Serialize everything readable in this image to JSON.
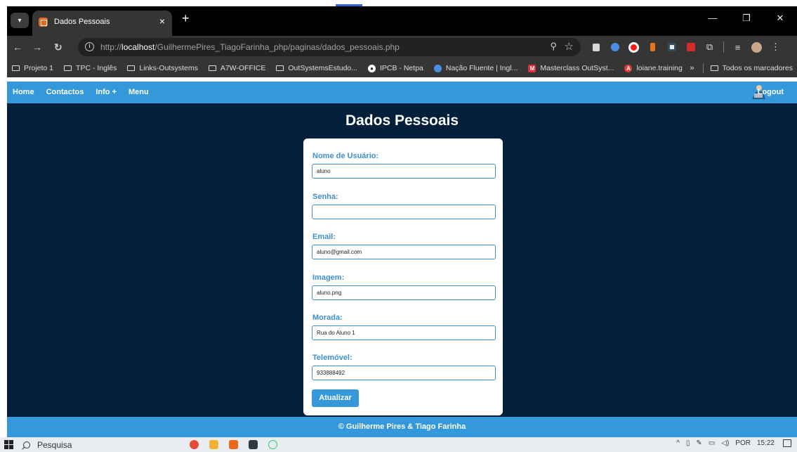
{
  "browser": {
    "tab_title": "Dados Pessoais",
    "tab_close": "×",
    "new_tab": "+",
    "url_prefix": "http://",
    "url_host": "localhost",
    "url_path": "/GuilhermePires_TiagoFarinha_php/paginas/dados_pessoais.php",
    "window_controls": [
      "—",
      "❐",
      "✕"
    ]
  },
  "bookmarks": [
    {
      "label": "Projeto 1",
      "icon": "folder-icon"
    },
    {
      "label": "TPC - Inglês",
      "icon": "folder-icon"
    },
    {
      "label": "Links-Outsystems",
      "icon": "folder-icon"
    },
    {
      "label": "A7W-OFFICE",
      "icon": "folder-icon"
    },
    {
      "label": "OutSystemsEstudo...",
      "icon": "folder-icon"
    },
    {
      "label": "IPCB - Netpa",
      "icon": "ipcb-icon"
    },
    {
      "label": "Nação Fluente | Ingl...",
      "icon": "nacao-fluente-icon"
    },
    {
      "label": "Masterclass OutSyst...",
      "icon": "masterclass-icon"
    },
    {
      "label": "loiane.training",
      "icon": "loiane-icon"
    }
  ],
  "bookmarks_more": "»",
  "bookmarks_all": "Todos os marcadores",
  "site": {
    "nav": [
      "Home",
      "Contactos",
      "Info +",
      "Menu"
    ],
    "logout": "Logout",
    "title": "Dados Pessoais",
    "form": {
      "username_label": "Nome de Usuário:",
      "username_value": "aluno",
      "password_label": "Senha:",
      "password_value": "",
      "email_label": "Email:",
      "email_value": "aluno@gmail.com",
      "image_label": "Imagem:",
      "image_value": "aluno.png",
      "address_label": "Morada:",
      "address_value": "Rua do Aluno 1",
      "phone_label": "Telemóvel:",
      "phone_value": "933888492",
      "submit_label": "Atualizar"
    },
    "footer": "© Guilherme Pires & Tiago Farinha"
  },
  "taskbar": {
    "search_placeholder": "Pesquisa",
    "language": "POR",
    "time": "15:22"
  },
  "colors": {
    "page_background": "#021f3b",
    "accent_blue": "#3498db",
    "label_blue": "#3e8ed0"
  }
}
